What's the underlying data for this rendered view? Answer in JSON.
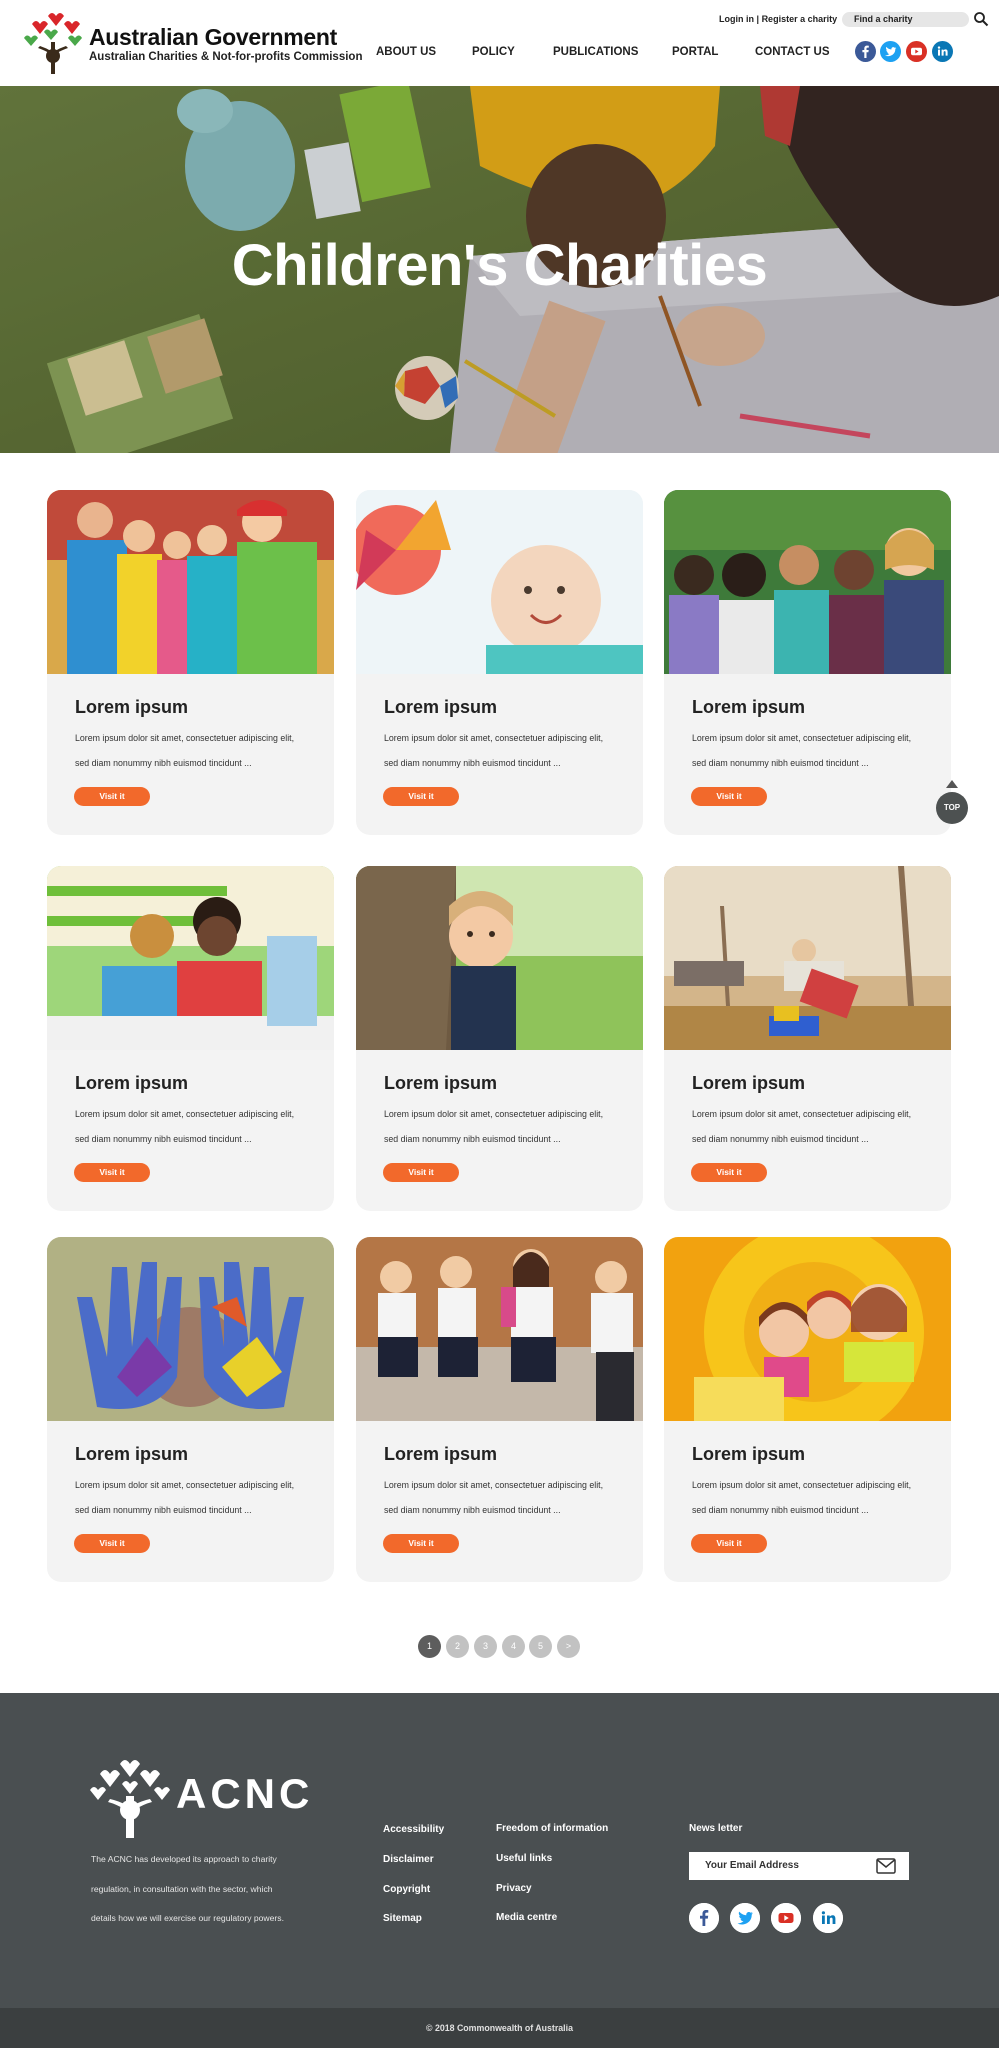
{
  "header": {
    "gov_title": "Australian Government",
    "gov_subtitle": "Australian Charities & Not-for-profits Commission",
    "login_label": "Login in",
    "separator": "|",
    "register_label": "Register a charity",
    "find_placeholder": "Find a charity",
    "nav": [
      "ABOUT US",
      "POLICY",
      "PUBLICATIONS",
      "PORTAL",
      "CONTACT US"
    ],
    "social": [
      "facebook-icon",
      "twitter-icon",
      "youtube-icon",
      "linkedin-icon"
    ]
  },
  "hero": {
    "title": "Children's Charities"
  },
  "cards": [
    {
      "title": "Lorem ipsum",
      "line1": "Lorem ipsum dolor sit amet, consectetuer adipiscing elit,",
      "line2": "sed diam nonummy nibh euismod tincidunt ...",
      "button": "Visit it"
    },
    {
      "title": "Lorem ipsum",
      "line1": "Lorem ipsum dolor sit amet, consectetuer adipiscing elit,",
      "line2": "sed diam nonummy nibh euismod tincidunt ...",
      "button": "Visit it"
    },
    {
      "title": "Lorem ipsum",
      "line1": "Lorem ipsum dolor sit amet, consectetuer adipiscing elit,",
      "line2": "sed diam nonummy nibh euismod tincidunt ...",
      "button": "Visit it"
    },
    {
      "title": "Lorem ipsum",
      "line1": "Lorem ipsum dolor sit amet, consectetuer adipiscing elit,",
      "line2": "sed diam nonummy nibh euismod tincidunt ...",
      "button": "Visit it"
    },
    {
      "title": "Lorem ipsum",
      "line1": "Lorem ipsum dolor sit amet, consectetuer adipiscing elit,",
      "line2": "sed diam nonummy nibh euismod tincidunt ...",
      "button": "Visit it"
    },
    {
      "title": "Lorem ipsum",
      "line1": "Lorem ipsum dolor sit amet, consectetuer adipiscing elit,",
      "line2": "sed diam nonummy nibh euismod tincidunt ...",
      "button": "Visit it"
    },
    {
      "title": "Lorem ipsum",
      "line1": "Lorem ipsum dolor sit amet, consectetuer adipiscing elit,",
      "line2": "sed diam nonummy nibh euismod tincidunt ...",
      "button": "Visit it"
    },
    {
      "title": "Lorem ipsum",
      "line1": "Lorem ipsum dolor sit amet, consectetuer adipiscing elit,",
      "line2": "sed diam nonummy nibh euismod tincidunt ...",
      "button": "Visit it"
    },
    {
      "title": "Lorem ipsum",
      "line1": "Lorem ipsum dolor sit amet, consectetuer adipiscing elit,",
      "line2": "sed diam nonummy nibh euismod tincidunt ...",
      "button": "Visit it"
    }
  ],
  "top_button": "TOP",
  "pagination": [
    "1",
    "2",
    "3",
    "4",
    "5",
    ">"
  ],
  "pagination_active": "1",
  "footer": {
    "logo_text": "ACNC",
    "desc": [
      "The ACNC has developed its approach to charity",
      "regulation, in consultation with the sector, which",
      "details how we will exercise our regulatory powers."
    ],
    "links_col1": [
      "Accessibility",
      "Disclaimer",
      "Copyright",
      "Sitemap"
    ],
    "links_col2": [
      "Freedom of information",
      "Useful links",
      "Privacy",
      "Media centre"
    ],
    "newsletter_label": "News letter",
    "email_placeholder": "Your Email Address",
    "social": [
      "facebook-icon",
      "twitter-icon",
      "youtube-icon",
      "linkedin-icon"
    ],
    "copyright": "© 2018 Commonwealth of Australia"
  },
  "colors": {
    "accent_orange": "#f2692b",
    "footer_bg": "#4a4f51",
    "bottom_bar": "#3b3f40",
    "facebook": "#3b5998",
    "twitter": "#1da1f2",
    "youtube": "#d93025",
    "linkedin": "#0a77b5"
  }
}
